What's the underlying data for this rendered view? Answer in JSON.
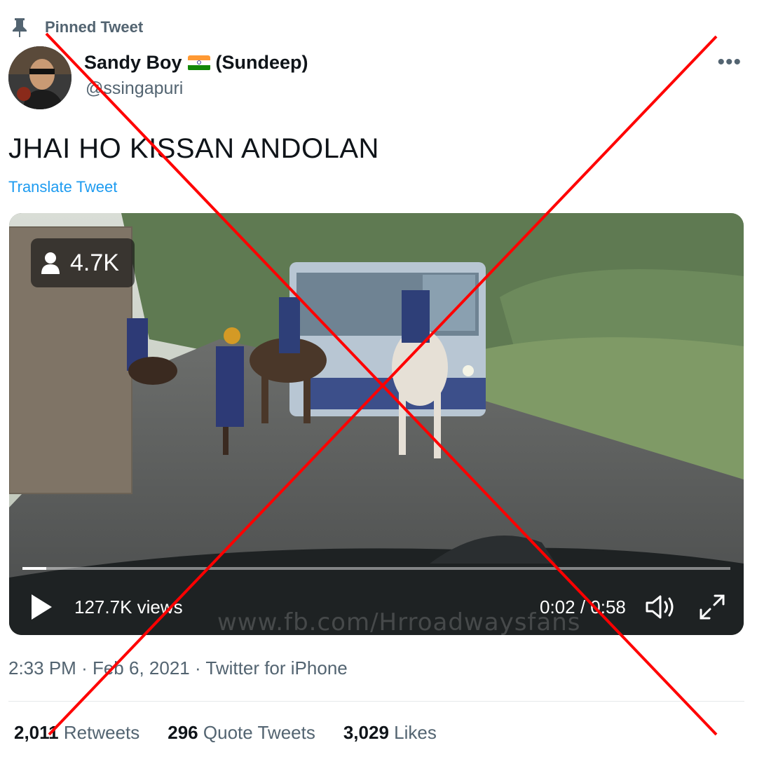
{
  "pinned": {
    "label": "Pinned Tweet",
    "icon": "pin-icon"
  },
  "author": {
    "display_name": "Sandy Boy",
    "flag": "india-flag-icon",
    "name_suffix": "(Sundeep)",
    "handle": "@ssingapuri"
  },
  "more_icon": "more-horizontal-icon",
  "tweet": {
    "text": "JHAI HO KISSAN ANDOLAN",
    "translate_label": "Translate Tweet"
  },
  "video": {
    "live_viewers": "4.7K",
    "views_label": "127.7K views",
    "time_label": "0:02 / 0:58",
    "progress_fraction": 0.034,
    "watermark": "www.fb.com/Hrroadwaysfans",
    "icons": {
      "play": "play-icon",
      "volume": "volume-icon",
      "fullscreen": "fullscreen-icon",
      "viewers": "person-icon"
    }
  },
  "meta": {
    "time": "2:33 PM",
    "separator": "·",
    "date": "Feb 6, 2021",
    "source": "Twitter for iPhone"
  },
  "stats": [
    {
      "value": "2,011",
      "label": "Retweets"
    },
    {
      "value": "296",
      "label": "Quote Tweets"
    },
    {
      "value": "3,029",
      "label": "Likes"
    }
  ],
  "colors": {
    "link": "#1d9bf0",
    "muted": "#536471",
    "cross": "#ff0000"
  }
}
